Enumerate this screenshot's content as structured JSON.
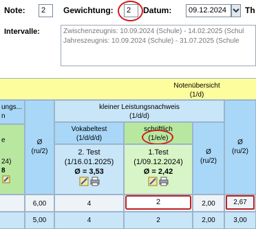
{
  "header": {
    "note_label": "Note:",
    "note_value": "2",
    "weight_label": "Gewichtung:",
    "weight_value": "2",
    "date_label": "Datum:",
    "date_value": "09.12.2024",
    "cut_label": "Th",
    "intervals_label": "Intervalle:",
    "intervals": [
      "Zwischenzeugnis: 10.09.2024 (Schule) - 14.02.2025 (Schul",
      "Jahreszeugnis: 10.09.2024 (Schule) - 31.07.2025 (Schule"
    ]
  },
  "table": {
    "overview_title": "Notenübersicht",
    "overview_sub": "(1/d)",
    "left_group_line1": "ungs...",
    "left_group_line2": "n",
    "left_sub_line1": "e",
    "left_sub_line2": "24)",
    "left_sub_line3": "8",
    "avg_label": "Ø",
    "avg_sub": "(ru/2)",
    "group_title": "kleiner Leistungsnachweis",
    "group_sub": "(1/d/d)",
    "col1_title": "Vokabeltest",
    "col1_sub": "(1/d/d/d)",
    "col1_test": "2. Test",
    "col1_date": "(1/16.01.2025)",
    "col1_avg": "Ø = 3,53",
    "col2_title": "schriftlich",
    "col2_sub": "(1/e/e)",
    "col2_test": "1.Test",
    "col2_date": "(1/09.12.2024)",
    "col2_avg": "Ø = 2,42",
    "avg2_label": "Ø",
    "avg2_sub": "(ru/2)",
    "avg3_label": "Ø",
    "avg3_sub": "(ru/2)",
    "rows": [
      {
        "c0": "",
        "c1": "6,00",
        "c2": "4",
        "c3": "2",
        "c4": "2,00",
        "c5": "2,67"
      },
      {
        "c0": "",
        "c1": "5,00",
        "c2": "4",
        "c3": "2",
        "c4": "2,00",
        "c5": "3,00"
      }
    ]
  }
}
